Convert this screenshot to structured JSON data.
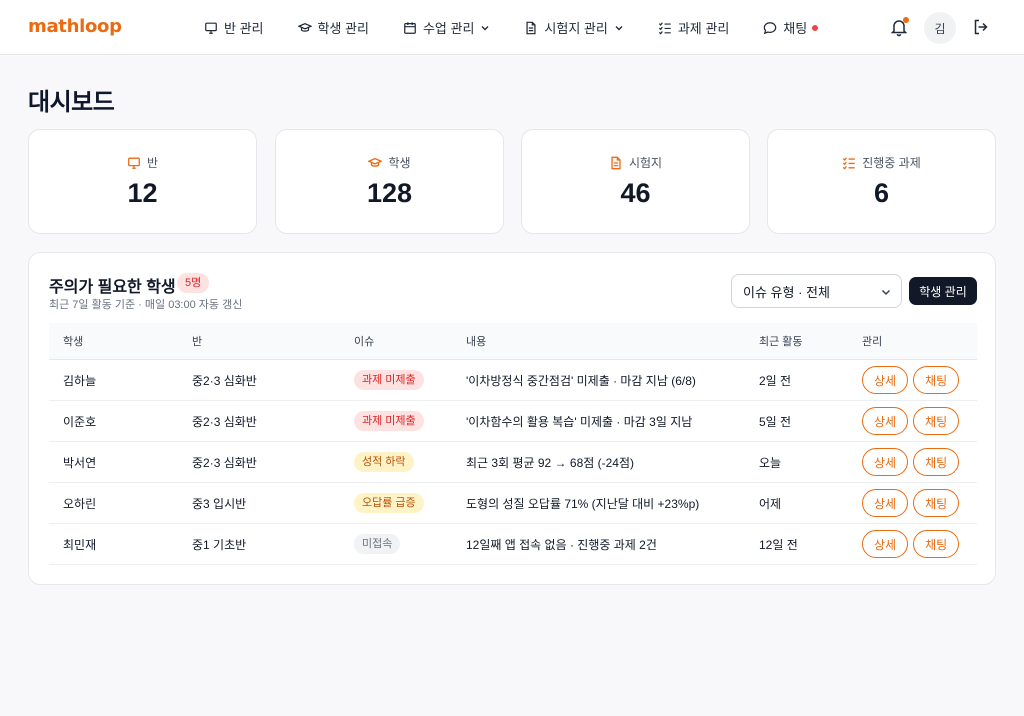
{
  "app": {
    "logo": "mathloop"
  },
  "nav": [
    {
      "label": "반 관리",
      "icon": "monitor-icon"
    },
    {
      "label": "학생 관리",
      "icon": "graduation-cap-icon"
    },
    {
      "label": "수업 관리",
      "icon": "calendar-icon",
      "dropdown": true
    },
    {
      "label": "시험지 관리",
      "icon": "document-icon",
      "dropdown": true
    },
    {
      "label": "과제 관리",
      "icon": "checklist-icon"
    },
    {
      "label": "채팅",
      "icon": "chat-icon",
      "unread": true
    }
  ],
  "user": {
    "avatar_initial": "김"
  },
  "page": {
    "title": "대시보드"
  },
  "stats": [
    {
      "label": "반",
      "value": "12",
      "icon": "monitor-icon"
    },
    {
      "label": "학생",
      "value": "128",
      "icon": "graduation-cap-icon"
    },
    {
      "label": "시험지",
      "value": "46",
      "icon": "document-icon"
    },
    {
      "label": "진행중 과제",
      "value": "6",
      "icon": "checklist-icon"
    }
  ],
  "attention": {
    "title": "주의가 필요한 학생",
    "count_badge": "5명",
    "subtitle": "최근 7일 활동 기준 · 매일 03:00 자동 갱신",
    "filter_value": "이슈 유형 · 전체",
    "manage_button": "학생 관리",
    "columns": [
      "학생",
      "반",
      "이슈",
      "내용",
      "최근 활동",
      "관리"
    ],
    "rows": [
      {
        "student": "김하늘",
        "class": "중2·3 심화반",
        "issue": "과제 미제출",
        "issue_color": "red",
        "detail": "'이차방정식 중간점검' 미제출 · 마감 지남 (6/8)",
        "last_activity": "2일 전"
      },
      {
        "student": "이준호",
        "class": "중2·3 심화반",
        "issue": "과제 미제출",
        "issue_color": "red",
        "detail": "'이차함수의 활용 복습' 미제출 · 마감 3일 지남",
        "last_activity": "5일 전"
      },
      {
        "student": "박서연",
        "class": "중2·3 심화반",
        "issue": "성적 하락",
        "issue_color": "yellow",
        "detail": "최근 3회 평균 92 → 68점 (-24점)",
        "last_activity": "오늘"
      },
      {
        "student": "오하린",
        "class": "중3 입시반",
        "issue": "오답률 급증",
        "issue_color": "yellow",
        "detail": "도형의 성질 오답률 71% (지난달 대비 +23%p)",
        "last_activity": "어제"
      },
      {
        "student": "최민재",
        "class": "중1 기초반",
        "issue": "미접속",
        "issue_color": "gray",
        "detail": "12일째 앱 접속 없음 · 진행중 과제 2건",
        "last_activity": "12일 전"
      }
    ],
    "detail_button": "상세",
    "chat_button": "채팅"
  },
  "colors": {
    "accent": "#ea6b12",
    "dark": "#111827",
    "red": "#dc2626"
  }
}
